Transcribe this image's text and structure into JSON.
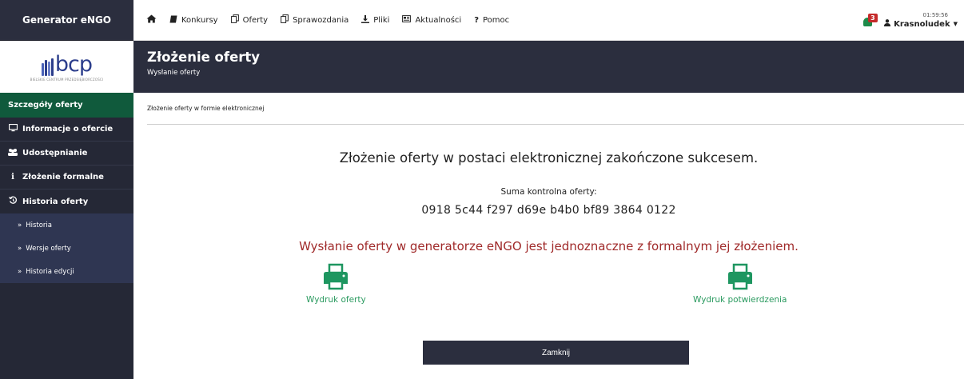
{
  "sidebar": {
    "brand": "Generator eNGO",
    "logo_text": "bcp",
    "logo_subtitle": "BIELSKIE CENTRUM PRZEDSIĘBIORCZOŚCI",
    "section_active": "Szczegóły oferty",
    "items": [
      {
        "label": "Informacje o ofercie",
        "icon": "monitor-icon"
      },
      {
        "label": "Udostępnianie",
        "icon": "users-icon"
      },
      {
        "label": "Złożenie formalne",
        "icon": "info-icon"
      },
      {
        "label": "Historia oferty",
        "icon": "history-icon"
      }
    ],
    "subitems": [
      {
        "label": "Historia"
      },
      {
        "label": "Wersje oferty"
      },
      {
        "label": "Historia edycji"
      }
    ]
  },
  "topnav": {
    "items": [
      {
        "label": "Konkursy",
        "icon": "book-icon"
      },
      {
        "label": "Oferty",
        "icon": "copy-icon"
      },
      {
        "label": "Sprawozdania",
        "icon": "copy-icon"
      },
      {
        "label": "Pliki",
        "icon": "download-icon"
      },
      {
        "label": "Aktualności",
        "icon": "newspaper-icon"
      },
      {
        "label": "Pomoc",
        "icon": "question-icon"
      }
    ],
    "notifications_count": "3",
    "time": "01:59:56",
    "user": "Krasnoludek"
  },
  "header": {
    "title": "Złożenie oferty",
    "subtitle": "Wysłanie oferty"
  },
  "content": {
    "breadcrumb": "Złożenie oferty w formie elektronicznej",
    "success": "Złożenie oferty w postaci elektronicznej zakończone sukcesem.",
    "checksum_label": "Suma kontrolna oferty:",
    "checksum": "0918 5c44 f297 d69e b4b0 bf89 3864 0122",
    "warning": "Wysłanie oferty w generatorze eNGO jest jednoznaczne z formalnym jej złożeniem.",
    "print_offer": "Wydruk oferty",
    "print_confirmation": "Wydruk potwierdzenia",
    "close_button": "Zamknij"
  },
  "colors": {
    "dark": "#2b2e3e",
    "active_green": "#105a3c",
    "link_green": "#2a9a5f",
    "warning_red": "#a02a2a"
  }
}
